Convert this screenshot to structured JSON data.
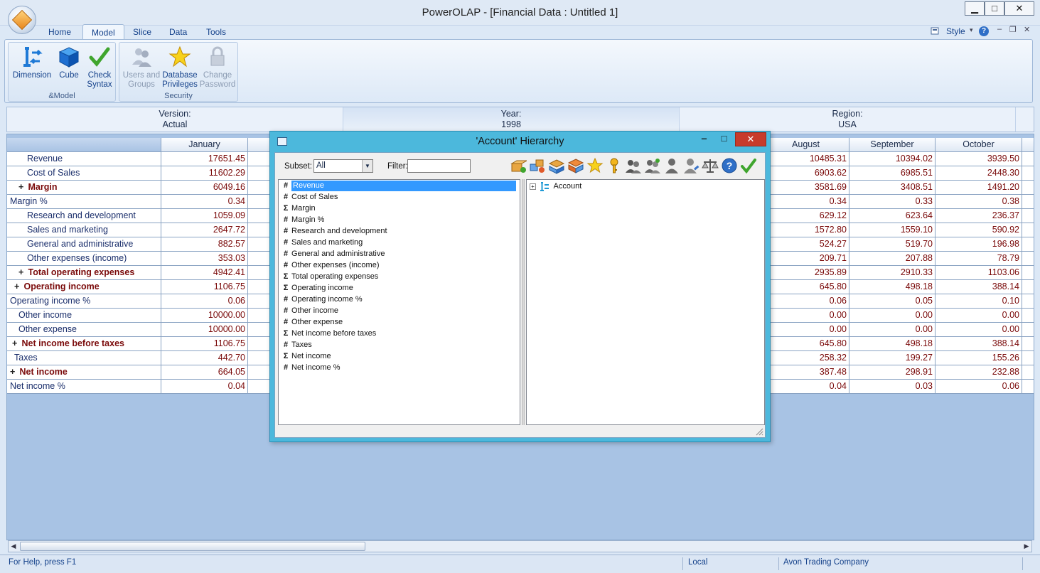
{
  "window": {
    "title": "PowerOLAP - [Financial Data : Untitled 1]",
    "controls": {
      "minimize": "▁",
      "maximize": "□",
      "close": "✕"
    }
  },
  "ribbon": {
    "tabs": [
      {
        "label": "Home"
      },
      {
        "label": "Model"
      },
      {
        "label": "Slice"
      },
      {
        "label": "Data"
      },
      {
        "label": "Tools"
      }
    ],
    "active_tab": "Model",
    "style_label": "Style",
    "mdi_controls": {
      "minimize": "‒",
      "restore": "❐",
      "close": "✕"
    },
    "groups": [
      {
        "caption": "&Model",
        "buttons": [
          {
            "label": "Dimension",
            "icon": "dimension-icon"
          },
          {
            "label": "Cube",
            "icon": "cube-icon"
          },
          {
            "label_line1": "Check",
            "label_line2": "Syntax",
            "icon": "check-syntax-icon"
          }
        ]
      },
      {
        "caption": "Security",
        "buttons": [
          {
            "label_line1": "Users and",
            "label_line2": "Groups",
            "icon": "users-groups-icon",
            "disabled": true
          },
          {
            "label_line1": "Database",
            "label_line2": "Privileges",
            "icon": "star-icon"
          },
          {
            "label_line1": "Change",
            "label_line2": "Password",
            "icon": "lock-icon",
            "disabled": true
          }
        ]
      }
    ]
  },
  "page_filters": [
    {
      "name": "Version:",
      "value": "Actual"
    },
    {
      "name": "Year:",
      "value": "1998"
    },
    {
      "name": "Region:",
      "value": "USA"
    }
  ],
  "grid": {
    "columns": {
      "jan": "January",
      "aug": "August",
      "sep": "September",
      "oct": "October"
    },
    "rows": [
      {
        "label": "Revenue",
        "indent": 2,
        "bold": false,
        "expand": false,
        "jan": "17651.45",
        "aug": "10485.31",
        "sep": "10394.02",
        "oct": "3939.50"
      },
      {
        "label": "Cost of Sales",
        "indent": 2,
        "bold": false,
        "expand": false,
        "jan": "11602.29",
        "aug": "6903.62",
        "sep": "6985.51",
        "oct": "2448.30"
      },
      {
        "label": "Margin",
        "indent": 1,
        "bold": true,
        "expand": true,
        "jan": "6049.16",
        "aug": "3581.69",
        "sep": "3408.51",
        "oct": "1491.20"
      },
      {
        "label": "Margin %",
        "indent": 0,
        "bold": false,
        "expand": false,
        "jan": "0.34",
        "aug": "0.34",
        "sep": "0.33",
        "oct": "0.38"
      },
      {
        "label": "Research and development",
        "indent": 2,
        "bold": false,
        "expand": false,
        "jan": "1059.09",
        "aug": "629.12",
        "sep": "623.64",
        "oct": "236.37"
      },
      {
        "label": "Sales and marketing",
        "indent": 2,
        "bold": false,
        "expand": false,
        "jan": "2647.72",
        "aug": "1572.80",
        "sep": "1559.10",
        "oct": "590.92"
      },
      {
        "label": "General and administrative",
        "indent": 2,
        "bold": false,
        "expand": false,
        "jan": "882.57",
        "aug": "524.27",
        "sep": "519.70",
        "oct": "196.98"
      },
      {
        "label": "Other expenses (income)",
        "indent": 2,
        "bold": false,
        "expand": false,
        "jan": "353.03",
        "aug": "209.71",
        "sep": "207.88",
        "oct": "78.79"
      },
      {
        "label": "Total operating expenses",
        "indent": 1,
        "bold": true,
        "expand": true,
        "jan": "4942.41",
        "aug": "2935.89",
        "sep": "2910.33",
        "oct": "1103.06"
      },
      {
        "label": "Operating income",
        "indent": 0.5,
        "bold": true,
        "expand": true,
        "jan": "1106.75",
        "aug": "645.80",
        "sep": "498.18",
        "oct": "388.14"
      },
      {
        "label": "Operating income %",
        "indent": 0,
        "bold": false,
        "expand": false,
        "jan": "0.06",
        "aug": "0.06",
        "sep": "0.05",
        "oct": "0.10"
      },
      {
        "label": "Other income",
        "indent": 1,
        "bold": false,
        "expand": false,
        "jan": "10000.00",
        "aug": "0.00",
        "sep": "0.00",
        "oct": "0.00"
      },
      {
        "label": "Other expense",
        "indent": 1,
        "bold": false,
        "expand": false,
        "jan": "10000.00",
        "aug": "0.00",
        "sep": "0.00",
        "oct": "0.00"
      },
      {
        "label": "Net income before taxes",
        "indent": 0.25,
        "bold": true,
        "expand": true,
        "jan": "1106.75",
        "aug": "645.80",
        "sep": "498.18",
        "oct": "388.14"
      },
      {
        "label": "Taxes",
        "indent": 0.5,
        "bold": false,
        "expand": false,
        "jan": "442.70",
        "aug": "258.32",
        "sep": "199.27",
        "oct": "155.26"
      },
      {
        "label": "Net income",
        "indent": 0,
        "bold": true,
        "expand": true,
        "jan": "664.05",
        "aug": "387.48",
        "sep": "298.91",
        "oct": "232.88"
      },
      {
        "label": "Net income %",
        "indent": 0,
        "bold": false,
        "expand": false,
        "jan": "0.04",
        "aug": "0.04",
        "sep": "0.03",
        "oct": "0.06"
      }
    ]
  },
  "status_bar": {
    "help": "For Help, press F1",
    "mode": "Local",
    "company": "Avon Trading Company"
  },
  "dialog": {
    "title": "'Account' Hierarchy",
    "controls": {
      "minimize": "‒",
      "maximize": "□",
      "close": "✕"
    },
    "subset_label": "Subset:",
    "subset_value": "All",
    "filter_label": "Filter:",
    "filter_value": "",
    "toolbar_icons": [
      "add-member-icon",
      "add-multiple-icon",
      "add-child-icon",
      "add-sibling-icon",
      "star-icon",
      "key-icon",
      "users-icon",
      "group-icon",
      "user-icon",
      "user-edit-icon",
      "balance-icon",
      "help-icon",
      "check-icon"
    ],
    "members": [
      {
        "symbol": "#",
        "label": "Revenue",
        "selected": true
      },
      {
        "symbol": "#",
        "label": "Cost of Sales"
      },
      {
        "symbol": "Σ",
        "label": "Margin"
      },
      {
        "symbol": "#",
        "label": "Margin %"
      },
      {
        "symbol": "#",
        "label": "Research and development"
      },
      {
        "symbol": "#",
        "label": "Sales and marketing"
      },
      {
        "symbol": "#",
        "label": "General and administrative"
      },
      {
        "symbol": "#",
        "label": "Other expenses (income)"
      },
      {
        "symbol": "Σ",
        "label": "Total operating expenses"
      },
      {
        "symbol": "Σ",
        "label": "Operating income"
      },
      {
        "symbol": "#",
        "label": "Operating income %"
      },
      {
        "symbol": "#",
        "label": "Other income"
      },
      {
        "symbol": "#",
        "label": "Other expense"
      },
      {
        "symbol": "Σ",
        "label": "Net income before taxes"
      },
      {
        "symbol": "#",
        "label": "Taxes"
      },
      {
        "symbol": "Σ",
        "label": "Net income"
      },
      {
        "symbol": "#",
        "label": "Net income %"
      }
    ],
    "tree_root": "Account",
    "tree_expander": "+"
  }
}
